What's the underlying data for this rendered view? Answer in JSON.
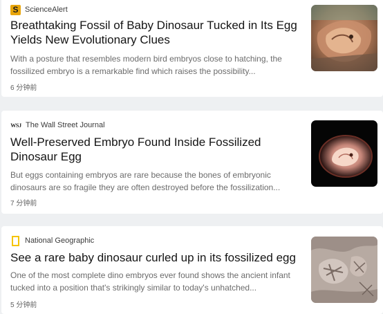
{
  "articles": [
    {
      "source": "ScienceAlert",
      "source_logo": "sciencealert-logo-icon",
      "logo_letter": "S",
      "headline": "Breathtaking Fossil of Baby Dinosaur Tucked in Its Egg Yields New Evolutionary Clues",
      "snippet": "With a posture that resembles modern bird embryos close to hatching, the fossilized embryo is a remarkable find which raises the possibility...",
      "time": "6 分钟前",
      "thumbnail": "fossil-embryo-illustration-image"
    },
    {
      "source": "The Wall Street Journal",
      "source_logo": "wsj-logo-icon",
      "logo_letter": "WSJ",
      "headline": "Well-Preserved Embryo Found Inside Fossilized Dinosaur Egg",
      "snippet": "But eggs containing embryos are rare because the bones of embryonic dinosaurs are so fragile they are often destroyed before the fossilization...",
      "time": "7 分钟前",
      "thumbnail": "embryo-in-egg-image"
    },
    {
      "source": "National Geographic",
      "source_logo": "national-geographic-logo-icon",
      "headline": "See a rare baby dinosaur curled up in its fossilized egg",
      "snippet": "One of the most complete dino embryos ever found shows the ancient infant tucked into a position that's strikingly similar to today's unhatched...",
      "time": "5 分钟前",
      "thumbnail": "fossil-bones-image"
    }
  ],
  "colors": {
    "page_background": "#eef0f2",
    "card_background": "#ffffff",
    "headline": "#141414",
    "snippet": "#6b6b6b",
    "sciencealert_brand": "#e8a50b",
    "natgeo_brand": "#f5c400"
  }
}
